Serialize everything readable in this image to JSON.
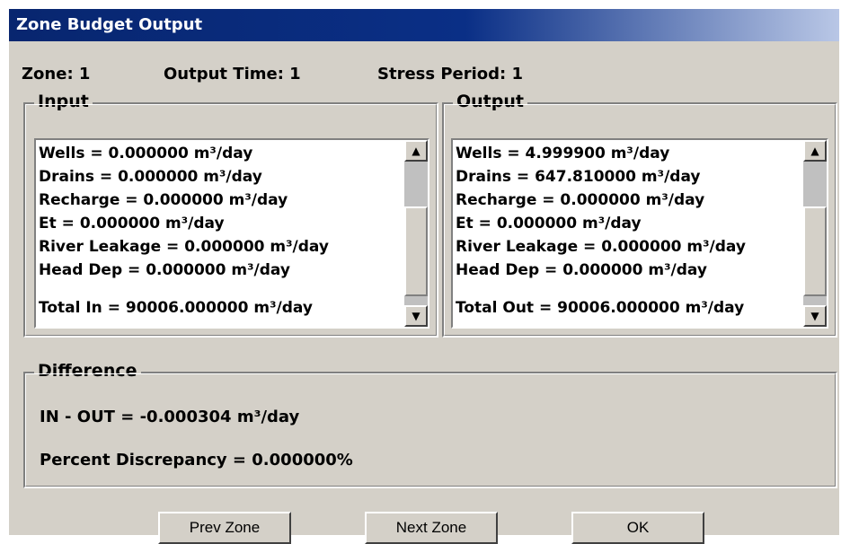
{
  "window": {
    "title": "Zone Budget Output"
  },
  "info": {
    "zone": "Zone: 1",
    "output_time": "Output Time: 1",
    "stress_period": "Stress Period: 1"
  },
  "input": {
    "label": "Input",
    "lines": [
      "Wells = 0.000000 m³/day",
      "Drains = 0.000000 m³/day",
      "Recharge = 0.000000 m³/day",
      "Et = 0.000000 m³/day",
      "River Leakage = 0.000000 m³/day",
      "Head Dep = 0.000000 m³/day"
    ],
    "total": "Total In = 90006.000000 m³/day"
  },
  "output": {
    "label": "Output",
    "lines": [
      "Wells = 4.999900 m³/day",
      "Drains = 647.810000 m³/day",
      "Recharge = 0.000000 m³/day",
      "Et = 0.000000 m³/day",
      "River Leakage = 0.000000 m³/day",
      "Head Dep = 0.000000 m³/day"
    ],
    "total": "Total Out = 90006.000000 m³/day"
  },
  "difference": {
    "label": "Difference",
    "in_out": "IN - OUT = -0.000304 m³/day",
    "percent": "Percent Discrepancy = 0.000000%"
  },
  "buttons": {
    "prev": "Prev Zone",
    "next": "Next Zone",
    "ok": "OK"
  }
}
